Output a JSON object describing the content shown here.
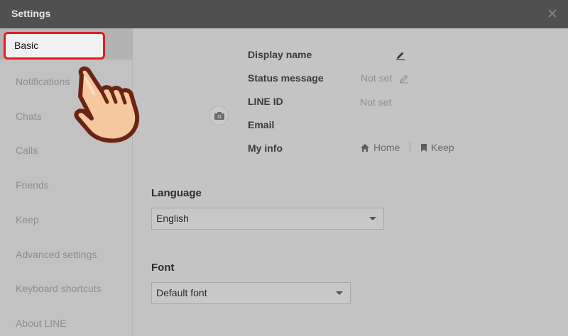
{
  "window": {
    "title": "Settings"
  },
  "sidebar": {
    "items": [
      {
        "label": "Basic"
      },
      {
        "label": "Notifications"
      },
      {
        "label": "Chats"
      },
      {
        "label": "Calls"
      },
      {
        "label": "Friends"
      },
      {
        "label": "Keep"
      },
      {
        "label": "Advanced settings"
      },
      {
        "label": "Keyboard shortcuts"
      },
      {
        "label": "About LINE"
      }
    ]
  },
  "profile": {
    "display_name_label": "Display name",
    "status_message_label": "Status message",
    "status_message_value": "Not set",
    "line_id_label": "LINE ID",
    "line_id_value": "Not set",
    "email_label": "Email",
    "my_info_label": "My info",
    "my_info_home": "Home",
    "my_info_keep": "Keep"
  },
  "language": {
    "title": "Language",
    "selected": "English"
  },
  "font": {
    "title": "Font",
    "selected": "Default font"
  },
  "colors": {
    "highlight": "#e41b23",
    "titlebar": "#505050",
    "overlay": "#c4c4c4"
  }
}
